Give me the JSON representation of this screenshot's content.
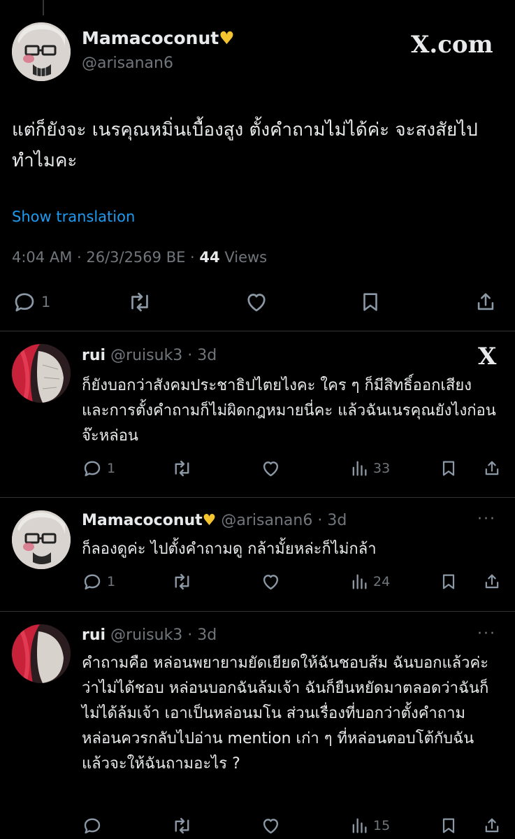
{
  "main_post": {
    "display_name": "Mamacoconut",
    "handle": "@arisanan6",
    "watermark": "X.com",
    "text": "แต่ก็ยังจะ เนรคุณหมิ่นเบื้องสูง ตั้งคำถามไม่ได้ค่ะ จะสงสัยไปทำไมคะ",
    "translate_label": "Show translation",
    "timestamp": "4:04 AM · 26/3/2569 BE ·",
    "views_count": "44",
    "views_label": "Views",
    "reply_count": "1"
  },
  "replies": [
    {
      "display_name": "rui",
      "handle": "@ruisuk3 · 3d",
      "text": "ก็ยังบอกว่าสังคมประชาธิปไตยไงคะ ใคร ๆ ก็มีสิทธิ์ออกเสียง และการตั้งคำถามก็ไม่ผิดกฎหมายนี่คะ แล้วฉันเนรคุณยังไงก่อนจ๊ะหล่อน",
      "reply_count": "1",
      "views": "33",
      "corner": "X"
    },
    {
      "display_name": "Mamacoconut",
      "handle": "@arisanan6 · 3d",
      "text": "ก็ลองดูค่ะ ไปตั้งคำถามดู กล้ามั้ยหล่ะก็ไม่กล้า",
      "reply_count": "1",
      "views": "24",
      "corner": "···"
    },
    {
      "display_name": "rui",
      "handle": "@ruisuk3 · 3d",
      "text": "คำถามคือ หล่อนพยายามยัดเยียดให้ฉันชอบส้ม ฉันบอกแล้วค่ะว่าไม่ได้ชอบ หล่อนบอกฉันล้มเจ้า ฉันก็ยืนหยัดมาตลอดว่าฉันก็ไม่ได้ล้มเจ้า เอาเป็นหล่อนมโน ส่วนเรื่องที่บอกว่าตั้งคำถาม หล่อนควรกลับไปอ่าน mention เก่า ๆ ที่หล่อนตอบโต้กับฉัน แล้วจะให้ฉันถามอะไร ?",
      "reply_count": "",
      "views": "15",
      "corner": "···"
    }
  ],
  "colors": {
    "background": "#000000",
    "text": "#e7e9ea",
    "muted": "#71767b",
    "link": "#1d9bf0",
    "heart": "#f4c430"
  }
}
